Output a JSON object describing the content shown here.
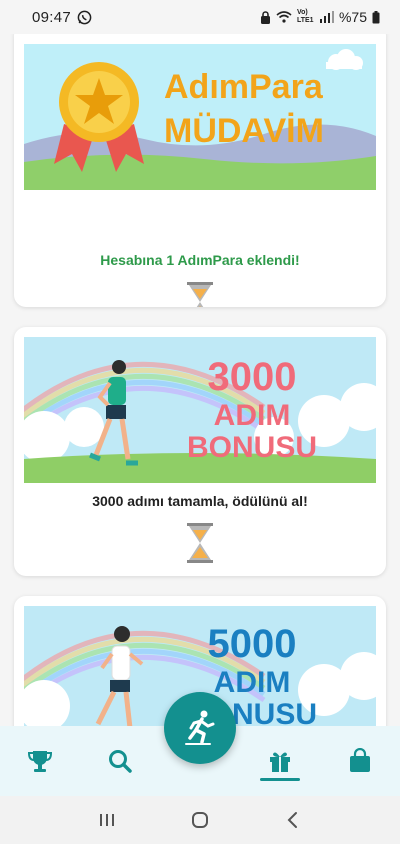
{
  "status_bar": {
    "time": "09:47",
    "network_label": "Vo) LTE1",
    "battery": "%75"
  },
  "cards": [
    {
      "banner_title_line1": "AdımPara",
      "banner_title_line2": "MÜDAVİM",
      "message": "Hesabına 1 AdımPara eklendi!"
    },
    {
      "banner_title_line1": "3000",
      "banner_title_line2": "ADIM",
      "banner_title_line3": "BONUSU",
      "message": "3000 adımı tamamla, ödülünü al!"
    },
    {
      "banner_title_line1": "5000",
      "banner_title_line2": "ADIM",
      "banner_title_line3": "BONUSU"
    }
  ],
  "bottom_nav": {
    "items": [
      {
        "icon": "trophy-icon"
      },
      {
        "icon": "search-icon"
      },
      {
        "icon": "runner-icon"
      },
      {
        "icon": "gift-icon",
        "active": true
      },
      {
        "icon": "shopping-bag-icon"
      }
    ]
  },
  "colors": {
    "teal": "#13908f",
    "green_text": "#2e9a4a",
    "gold": "#f2b01e",
    "pink": "#f06b7a",
    "blue": "#1a7fc1"
  }
}
